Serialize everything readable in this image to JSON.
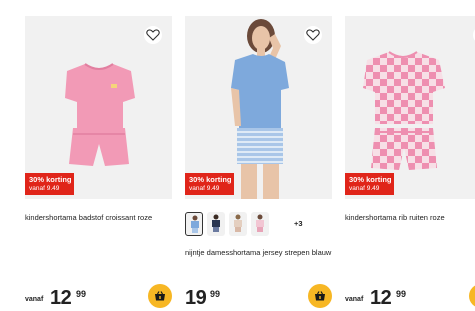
{
  "products": [
    {
      "badge_title": "30% korting",
      "badge_sub": "vanaf 9.49",
      "title": "kindershortama badstof croissant roze",
      "price_prefix": "vanaf",
      "price_whole": "12",
      "price_cents": "99"
    },
    {
      "badge_title": "30% korting",
      "badge_sub": "vanaf 9.49",
      "title": "nijntje damesshortama jersey strepen blauw",
      "swatches_more": "+3",
      "price_whole": "19",
      "price_cents": "99"
    },
    {
      "badge_title": "30% korting",
      "badge_sub": "vanaf 9.49",
      "title": "kindershortama rib ruiten roze",
      "price_prefix": "vanaf",
      "price_whole": "12",
      "price_cents": "99"
    }
  ],
  "colors": {
    "badge": "#e0251a",
    "cart_button": "#f7b724",
    "image_background": "#f1f1f1",
    "pink_product": "#f29ab6",
    "blue_product": "#7ea9dc"
  },
  "icons": {
    "favorite": "heart-icon",
    "add_to_cart": "shopping-basket-icon"
  }
}
